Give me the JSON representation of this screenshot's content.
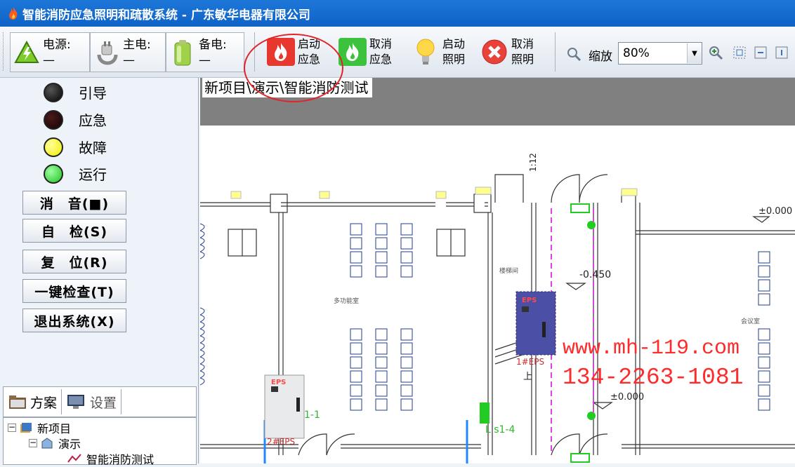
{
  "window": {
    "title": "智能消防应急照明和疏散系统 - 广东敏华电器有限公司"
  },
  "toolbar": {
    "power_label": "电源:",
    "power_value": "—",
    "main_power_label": "主电:",
    "main_power_value": "—",
    "backup_power_label": "备电:",
    "backup_power_value": "—",
    "start_emergency": [
      "启动",
      "应急"
    ],
    "cancel_emergency": [
      "取消",
      "应急"
    ],
    "start_lighting": [
      "启动",
      "照明"
    ],
    "cancel_lighting": [
      "取消",
      "照明"
    ],
    "zoom_label": "缩放",
    "zoom_value": "80%"
  },
  "status_lights": [
    {
      "label": "引导",
      "color": "#050505"
    },
    {
      "label": "应急",
      "color": "#1a0505"
    },
    {
      "label": "故障",
      "color": "#f2ef00"
    },
    {
      "label": "运行",
      "color": "#22c222"
    }
  ],
  "side_buttons": {
    "mute": "消　音(■)",
    "self_check": "自　检(S)",
    "reset": "复　位(R)",
    "one_key_check": "一键检查(T)",
    "exit": "退出系统(X)"
  },
  "tabs": {
    "plan": "方案",
    "settings": "设置"
  },
  "tree": {
    "root": "新项目",
    "child": "演示",
    "leaf": "智能消防测试"
  },
  "breadcrumb": "新项目\\演示\\智能消防测试",
  "drawing": {
    "scale_note": "1:12",
    "elevation_0": "±0.000",
    "elevation_neg": "-0.450",
    "elevation_0b": "±0.000",
    "eps_text": "EPS",
    "eps1_label": "1#EPS",
    "eps2_label": "2#EPS",
    "line_1_1": "1-1",
    "line_ls1_4": "L s1-4",
    "room_stair": "上",
    "watermark_url": "www.mh-119.com",
    "watermark_phone": "134-2263-1081",
    "room_a": "多功能室",
    "room_b": "楼梯间",
    "room_c": "会议室"
  }
}
